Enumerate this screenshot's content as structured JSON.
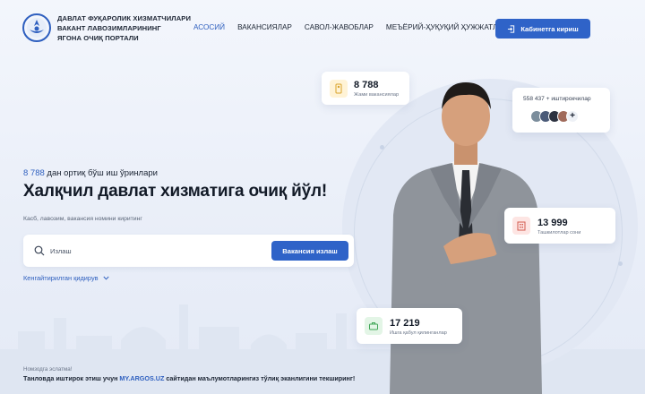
{
  "colors": {
    "accent": "#2f63c8",
    "background": "#eef2fa",
    "text": "#1b2433"
  },
  "header": {
    "title_lines": [
      "ДАВЛАТ ФУҚАРОЛИК ХИЗМАТЧИЛАРИ",
      "ВАКАНТ ЛАВОЗИМЛАРИНИНГ",
      "ЯГОНА ОЧИҚ ПОРТАЛИ"
    ],
    "nav": [
      "АСОСИЙ",
      "ВАКАНСИЯЛАР",
      "САВОЛ-ЖАВОБЛАР",
      "МЕЪЁРИЙ-ҲУҚУҚИЙ ҲУЖЖАТЛАР"
    ],
    "active_nav": "АСОСИЙ",
    "cabinet_button": "Кабинетга кириш",
    "cabinet_icon": "login-icon",
    "logo_icon": "emblem-logo"
  },
  "hero": {
    "count_number": "8 788",
    "count_text": " дан ортиқ бўш иш ўринлари",
    "title": "Халқчил давлат хизматига очиқ йўл!",
    "hint": "Касб, лавозим, вакансия номини киритинг",
    "search_placeholder": "Излаш",
    "search_button": "Вакансия излаш",
    "advanced_search": "Кенгайтирилган қидирув"
  },
  "stats": {
    "vacancies": {
      "value": "8 788",
      "label": "Жами вакансиялар",
      "icon": "vacancy-icon"
    },
    "participants": {
      "label": "558 437 + иштирокчилар",
      "icon": "avatars"
    },
    "organizations": {
      "value": "13 999",
      "label": "Ташкилотлар сони",
      "icon": "building-icon"
    },
    "accepted": {
      "value": "17 219",
      "label": "Ишга қабул қилинганлар",
      "icon": "briefcase-icon"
    }
  },
  "notice": {
    "label": "Номзодга эслатма!",
    "text_before": "Танловда иштирок этиш учун ",
    "link": "MY.ARGOS.UZ",
    "text_after": " сайтидан маълумотларингиз тўлиқ эканлигини текширинг!"
  }
}
